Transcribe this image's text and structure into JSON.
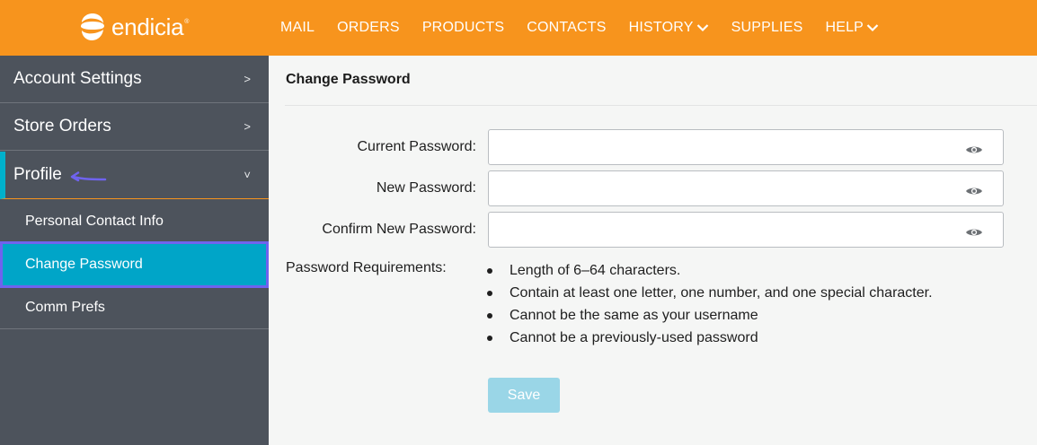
{
  "brand": {
    "name": "endicia",
    "trademark": "®"
  },
  "colors": {
    "header_orange": "#f7941d",
    "sidebar_bg": "#4d535c",
    "selected_teal": "#00a5c8",
    "highlight_outline": "#6f63ee",
    "arrow": "#6f63ee",
    "save_disabled": "#9ad6e7"
  },
  "nav": {
    "items": [
      {
        "label": "MAIL",
        "dropdown": false
      },
      {
        "label": "ORDERS",
        "dropdown": false
      },
      {
        "label": "PRODUCTS",
        "dropdown": false
      },
      {
        "label": "CONTACTS",
        "dropdown": false
      },
      {
        "label": "HISTORY",
        "dropdown": true
      },
      {
        "label": "SUPPLIES",
        "dropdown": false
      },
      {
        "label": "HELP",
        "dropdown": true
      }
    ]
  },
  "sidebar": {
    "sections": [
      {
        "label": "Account Settings",
        "chevron": ">"
      },
      {
        "label": "Store Orders",
        "chevron": ">"
      },
      {
        "label": "Profile",
        "chevron": "˅"
      }
    ],
    "subitems": [
      {
        "label": "Personal Contact Info"
      },
      {
        "label": "Change Password"
      },
      {
        "label": "Comm Prefs"
      }
    ]
  },
  "main": {
    "title": "Change Password",
    "fields": [
      {
        "label": "Current Password:",
        "value": "",
        "icon": "eye-icon"
      },
      {
        "label": "New Password:",
        "value": "",
        "icon": "eye-icon"
      },
      {
        "label": "Confirm New Password:",
        "value": "",
        "icon": "eye-icon"
      }
    ],
    "requirements_label": "Password Requirements:",
    "requirements": [
      "Length of 6–64 characters.",
      "Contain at least one letter, one number, and one special character.",
      "Cannot be the same as your username",
      "Cannot be a previously-used password"
    ],
    "save_label": "Save"
  }
}
